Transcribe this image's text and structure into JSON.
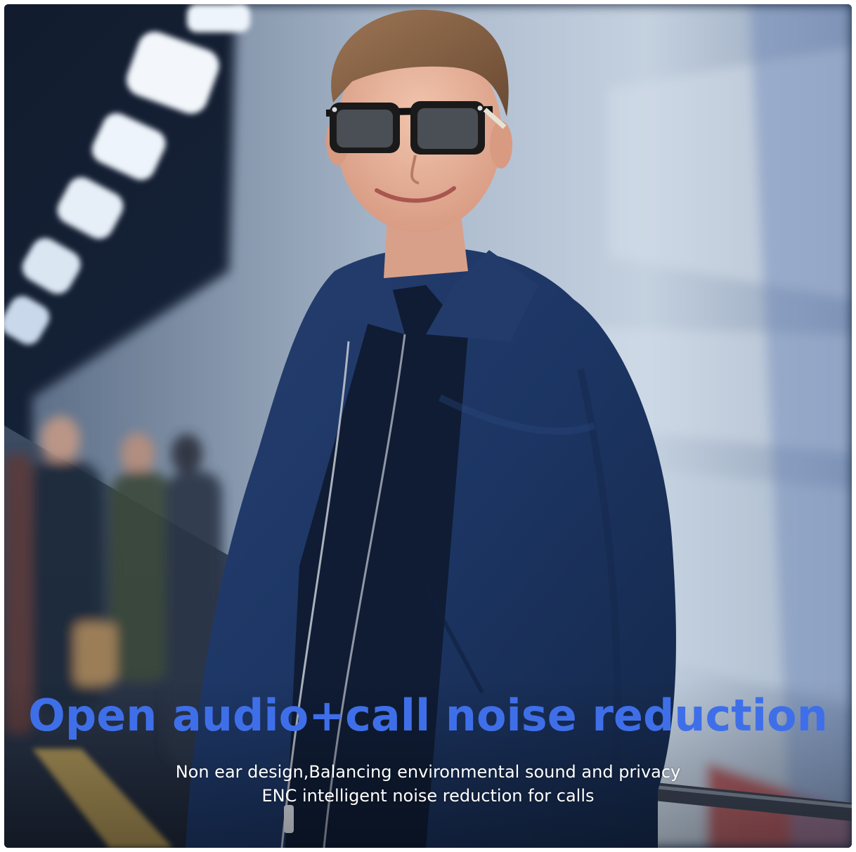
{
  "image": {
    "description_name": "subway-platform-sunglasses-ad",
    "colors": {
      "headline": "#3f6fe8",
      "subtext": "#ffffff",
      "jacket": "#1d3766",
      "platform_dark": "#0f1a2c",
      "train": "#b9c6d6"
    }
  },
  "caption": {
    "headline": "Open audio+call noise reduction",
    "line1": "Non ear design,Balancing environmental sound and privacy",
    "line2": "ENC intelligent noise reduction for calls"
  }
}
